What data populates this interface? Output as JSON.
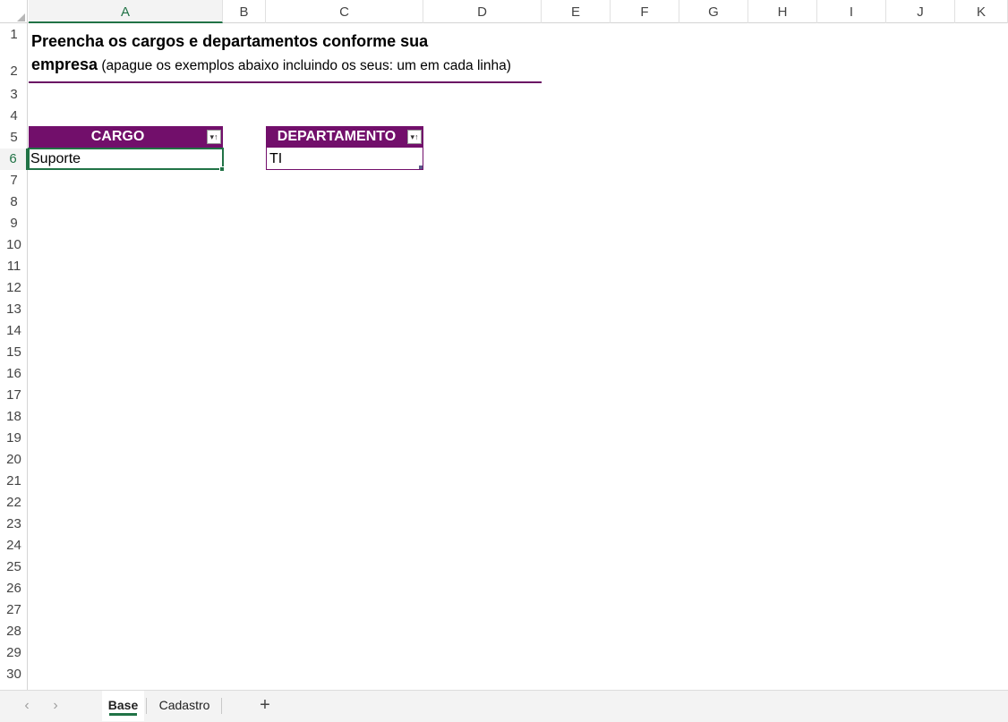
{
  "columns": [
    "A",
    "B",
    "C",
    "D",
    "E",
    "F",
    "G",
    "H",
    "I",
    "J",
    "K"
  ],
  "active_column": "A",
  "rows": [
    "1",
    "2",
    "3",
    "4",
    "5",
    "6",
    "7",
    "8",
    "9",
    "10",
    "11",
    "12",
    "13",
    "14",
    "15",
    "16",
    "17",
    "18",
    "19",
    "20",
    "21",
    "22",
    "23",
    "24",
    "25",
    "26",
    "27",
    "28",
    "29",
    "30"
  ],
  "active_row": "6",
  "title": {
    "line1": "Preencha os cargos e departamentos conforme sua",
    "line2_bold": "empresa",
    "line2_note": " (apague os exemplos abaixo incluindo os seus: um em cada linha)"
  },
  "tables": {
    "cargo": {
      "header": "CARGO",
      "values": [
        "Suporte"
      ]
    },
    "departamento": {
      "header": "DEPARTAMENTO",
      "values": [
        "TI"
      ]
    }
  },
  "filter_icon": "sort-filter-icon",
  "colors": {
    "table_header": "#720f6b",
    "accent_green": "#217346",
    "title_rule": "#6b1164"
  },
  "tabs": {
    "items": [
      {
        "label": "Base",
        "active": true
      },
      {
        "label": "Cadastro",
        "active": false
      }
    ],
    "prev_icon": "‹",
    "next_icon": "›",
    "add_icon": "+"
  }
}
